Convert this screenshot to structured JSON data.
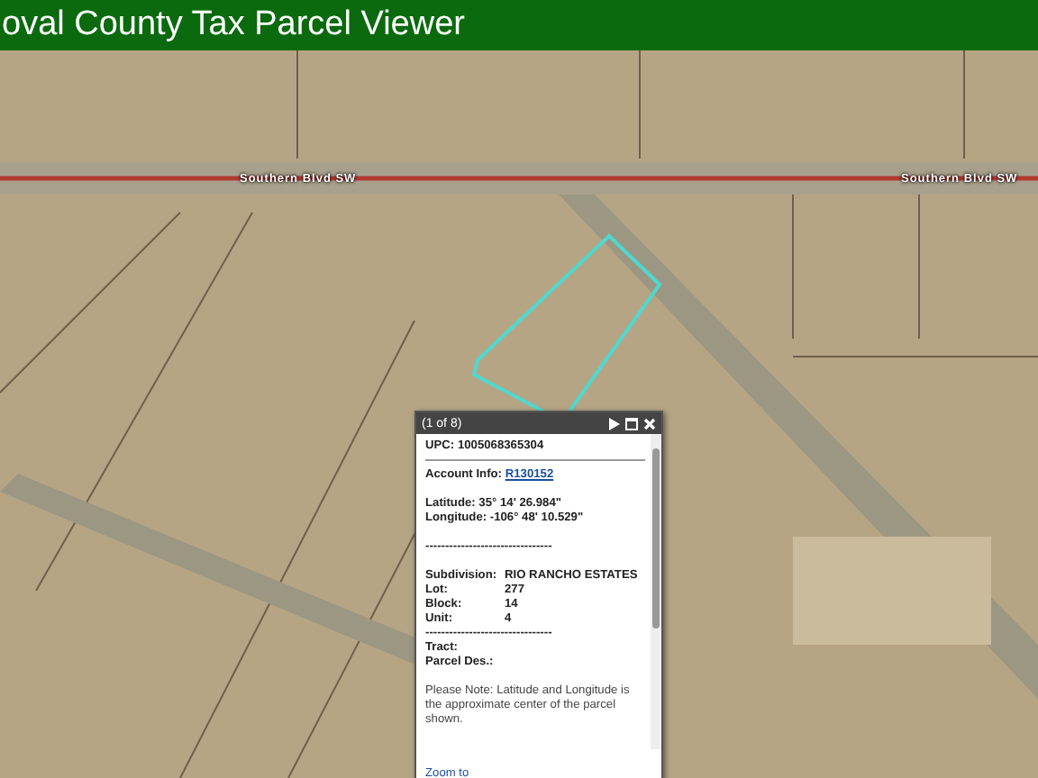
{
  "header": {
    "title": "oval County Tax Parcel Viewer"
  },
  "map": {
    "road_labels": [
      {
        "text": "Southern Blvd SW"
      },
      {
        "text": "Southern Blvd SW"
      }
    ]
  },
  "popup": {
    "title": "(1 of 8)",
    "lines": [
      {
        "kind": "field",
        "label": "UPC:",
        "value": "1005068365304"
      },
      {
        "kind": "rule"
      },
      {
        "kind": "link",
        "label": "Account Info:",
        "value": "R130152"
      },
      {
        "kind": "spacer"
      },
      {
        "kind": "field",
        "label": "Latitude:",
        "value": "35° 14' 26.984\""
      },
      {
        "kind": "field",
        "label": "Longitude:",
        "value": "-106° 48' 10.529\""
      },
      {
        "kind": "spacer"
      },
      {
        "kind": "dashes",
        "text": "--------------------------------"
      },
      {
        "kind": "spacer"
      },
      {
        "kind": "aligned",
        "label": "Subdivision:",
        "value": "RIO RANCHO ESTATES"
      },
      {
        "kind": "aligned",
        "label": "Lot:",
        "value": "277"
      },
      {
        "kind": "aligned",
        "label": "Block:",
        "value": "14"
      },
      {
        "kind": "aligned",
        "label": "Unit:",
        "value": "4"
      },
      {
        "kind": "dashes",
        "text": "--------------------------------"
      },
      {
        "kind": "field",
        "label": "Tract:"
      },
      {
        "kind": "field",
        "label": "Parcel Des.:"
      },
      {
        "kind": "spacer"
      },
      {
        "kind": "note",
        "text": "Please Note: Latitude and Longitude is the approximate center of the parcel shown."
      }
    ],
    "zoom_link": "Zoom to"
  }
}
